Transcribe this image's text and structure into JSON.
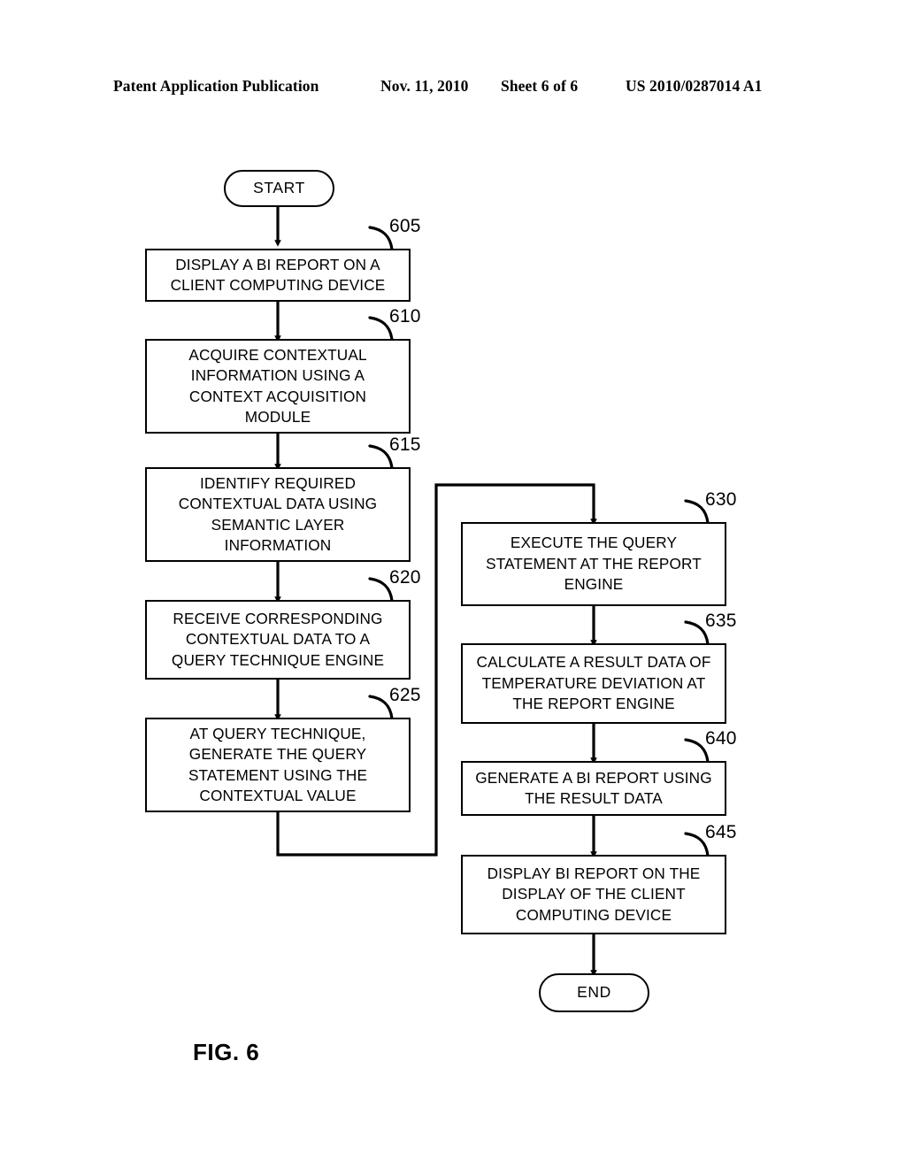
{
  "header": {
    "publication": "Patent Application Publication",
    "date": "Nov. 11, 2010",
    "sheet": "Sheet 6 of 6",
    "patent_number": "US 2010/0287014 A1"
  },
  "figure": {
    "caption": "FIG. 6"
  },
  "diagram": {
    "type": "flowchart",
    "start_label": "START",
    "end_label": "END",
    "nodes": [
      {
        "ref": "605",
        "text": "DISPLAY A BI REPORT ON A\nCLIENT COMPUTING DEVICE"
      },
      {
        "ref": "610",
        "text": "ACQUIRE CONTEXTUAL\nINFORMATION USING A\nCONTEXT ACQUISITION\nMODULE"
      },
      {
        "ref": "615",
        "text": "IDENTIFY REQUIRED\nCONTEXTUAL DATA USING\nSEMANTIC LAYER\nINFORMATION"
      },
      {
        "ref": "620",
        "text": "RECEIVE CORRESPONDING\nCONTEXTUAL DATA TO A\nQUERY TECHNIQUE ENGINE"
      },
      {
        "ref": "625",
        "text": "AT QUERY TECHNIQUE,\nGENERATE THE QUERY\nSTATEMENT USING THE\nCONTEXTUAL VALUE"
      },
      {
        "ref": "630",
        "text": "EXECUTE THE QUERY\nSTATEMENT AT THE REPORT\nENGINE"
      },
      {
        "ref": "635",
        "text": "CALCULATE A RESULT DATA OF\nTEMPERATURE DEVIATION AT\nTHE REPORT ENGINE"
      },
      {
        "ref": "640",
        "text": "GENERATE A BI REPORT USING\nTHE RESULT DATA"
      },
      {
        "ref": "645",
        "text": "DISPLAY BI REPORT ON THE\nDISPLAY OF THE CLIENT\nCOMPUTING DEVICE"
      }
    ]
  }
}
